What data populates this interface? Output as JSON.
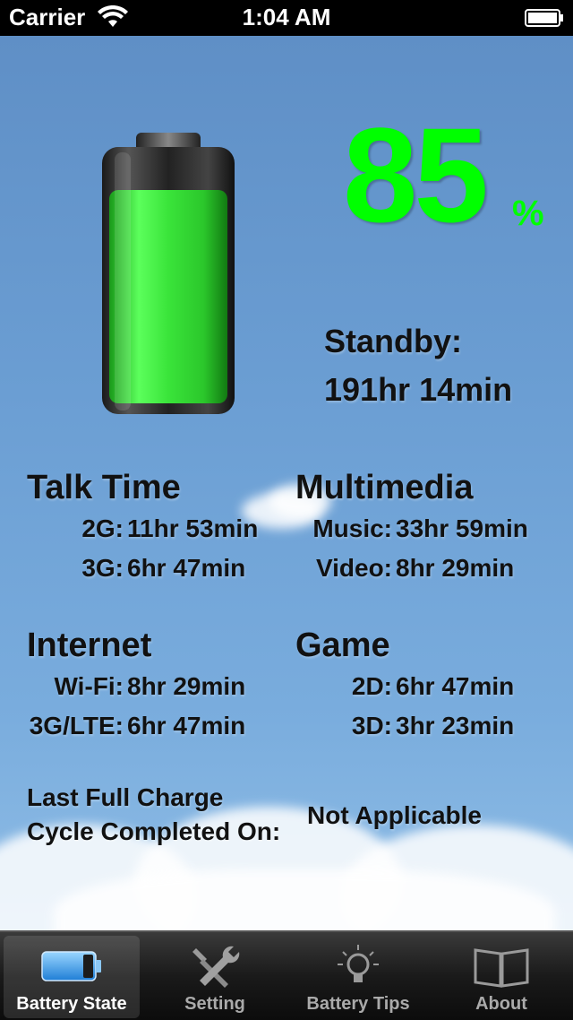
{
  "status_bar": {
    "carrier": "Carrier",
    "time": "1:04 AM"
  },
  "battery": {
    "level_percent": 85,
    "percent_value": "85",
    "percent_sign": "%",
    "fill_color": "#3cff3c"
  },
  "standby": {
    "label": "Standby:",
    "value": "191hr 14min"
  },
  "talk_time": {
    "title": "Talk Time",
    "rows": [
      {
        "label": "2G:",
        "value": "11hr 53min"
      },
      {
        "label": "3G:",
        "value": "6hr 47min"
      }
    ]
  },
  "multimedia": {
    "title": "Multimedia",
    "rows": [
      {
        "label": "Music:",
        "value": "33hr 59min"
      },
      {
        "label": "Video:",
        "value": "8hr 29min"
      }
    ]
  },
  "internet": {
    "title": "Internet",
    "rows": [
      {
        "label": "Wi-Fi:",
        "value": "8hr 29min"
      },
      {
        "label": "3G/LTE:",
        "value": "6hr 47min"
      }
    ]
  },
  "game": {
    "title": "Game",
    "rows": [
      {
        "label": "2D:",
        "value": "6hr 47min"
      },
      {
        "label": "3D:",
        "value": "3hr 23min"
      }
    ]
  },
  "last_charge": {
    "label_line1": "Last Full Charge",
    "label_line2": "Cycle Completed On:",
    "value": "Not Applicable"
  },
  "tabs": [
    {
      "label": "Battery State",
      "icon": "battery-icon",
      "active": true
    },
    {
      "label": "Setting",
      "icon": "tools-icon",
      "active": false
    },
    {
      "label": "Battery Tips",
      "icon": "lightbulb-icon",
      "active": false
    },
    {
      "label": "About",
      "icon": "book-icon",
      "active": false
    }
  ],
  "colors": {
    "percent_green": "#00ff00",
    "sky_blue": "#6b9ed3"
  }
}
